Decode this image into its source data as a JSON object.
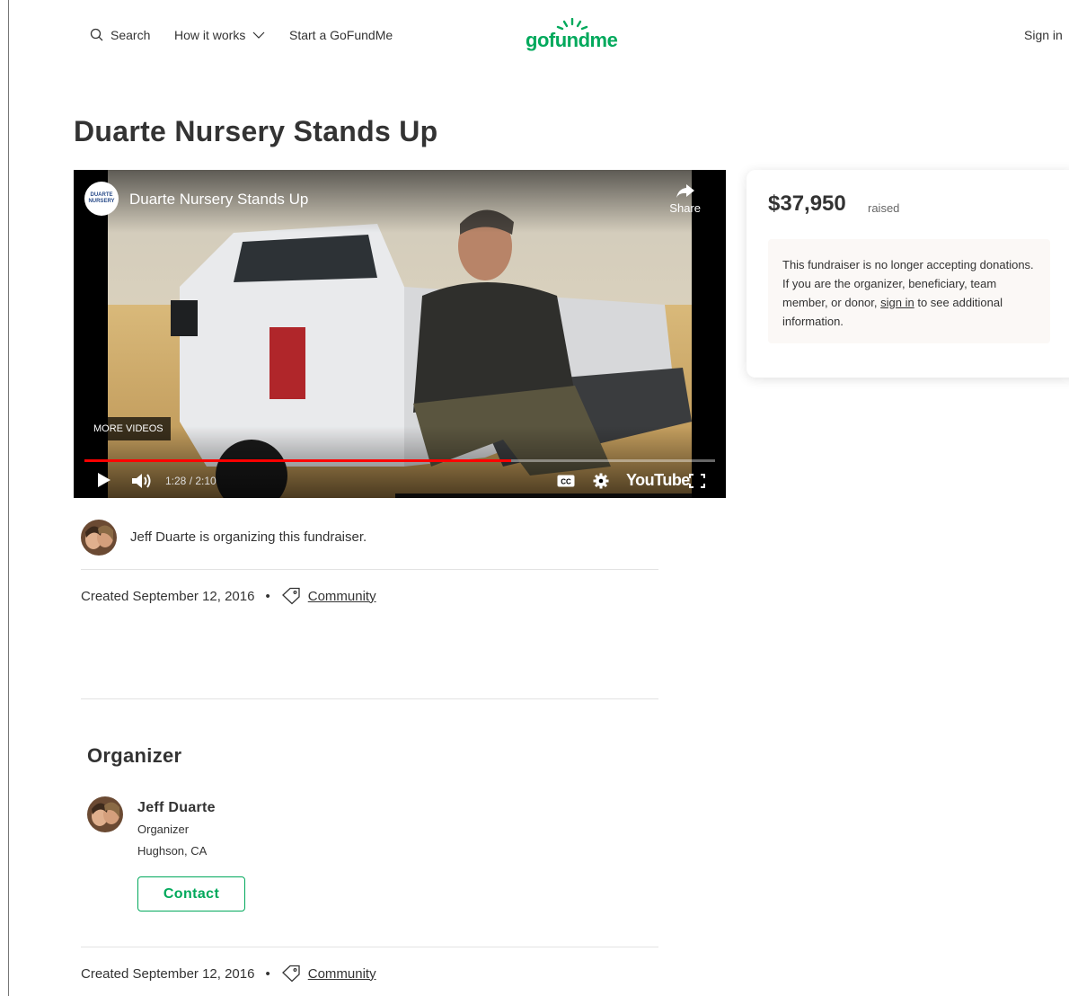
{
  "header": {
    "search_label": "Search",
    "how_it_works_label": "How it works",
    "start_label": "Start a GoFundMe",
    "logo_text": "gofundme",
    "sign_in_label": "Sign in",
    "brand_color": "#02a95c"
  },
  "campaign": {
    "title": "Duarte Nursery Stands Up"
  },
  "video": {
    "title": "Duarte Nursery Stands Up",
    "channel_logo_text": "DUARTE NURSERY",
    "share_label": "Share",
    "more_videos_label": "MORE VIDEOS",
    "timecode": "1:28 / 2:10",
    "progress_fraction": 0.677,
    "youtube_label": "YouTube"
  },
  "donation": {
    "amount": "$37,950",
    "raised_label": "raised",
    "notice_before": "This fundraiser is no longer accepting donations. If you are the organizer, beneficiary, team member, or donor,",
    "notice_link": "sign in",
    "notice_after": "to see additional information."
  },
  "organizer_line": "Jeff Duarte is organizing this fundraiser.",
  "meta": {
    "created": "Created September 12, 2016",
    "separator": "•",
    "category": "Community"
  },
  "organizer": {
    "heading": "Organizer",
    "name": "Jeff Duarte",
    "role": "Organizer",
    "location": "Hughson, CA",
    "contact_label": "Contact"
  }
}
